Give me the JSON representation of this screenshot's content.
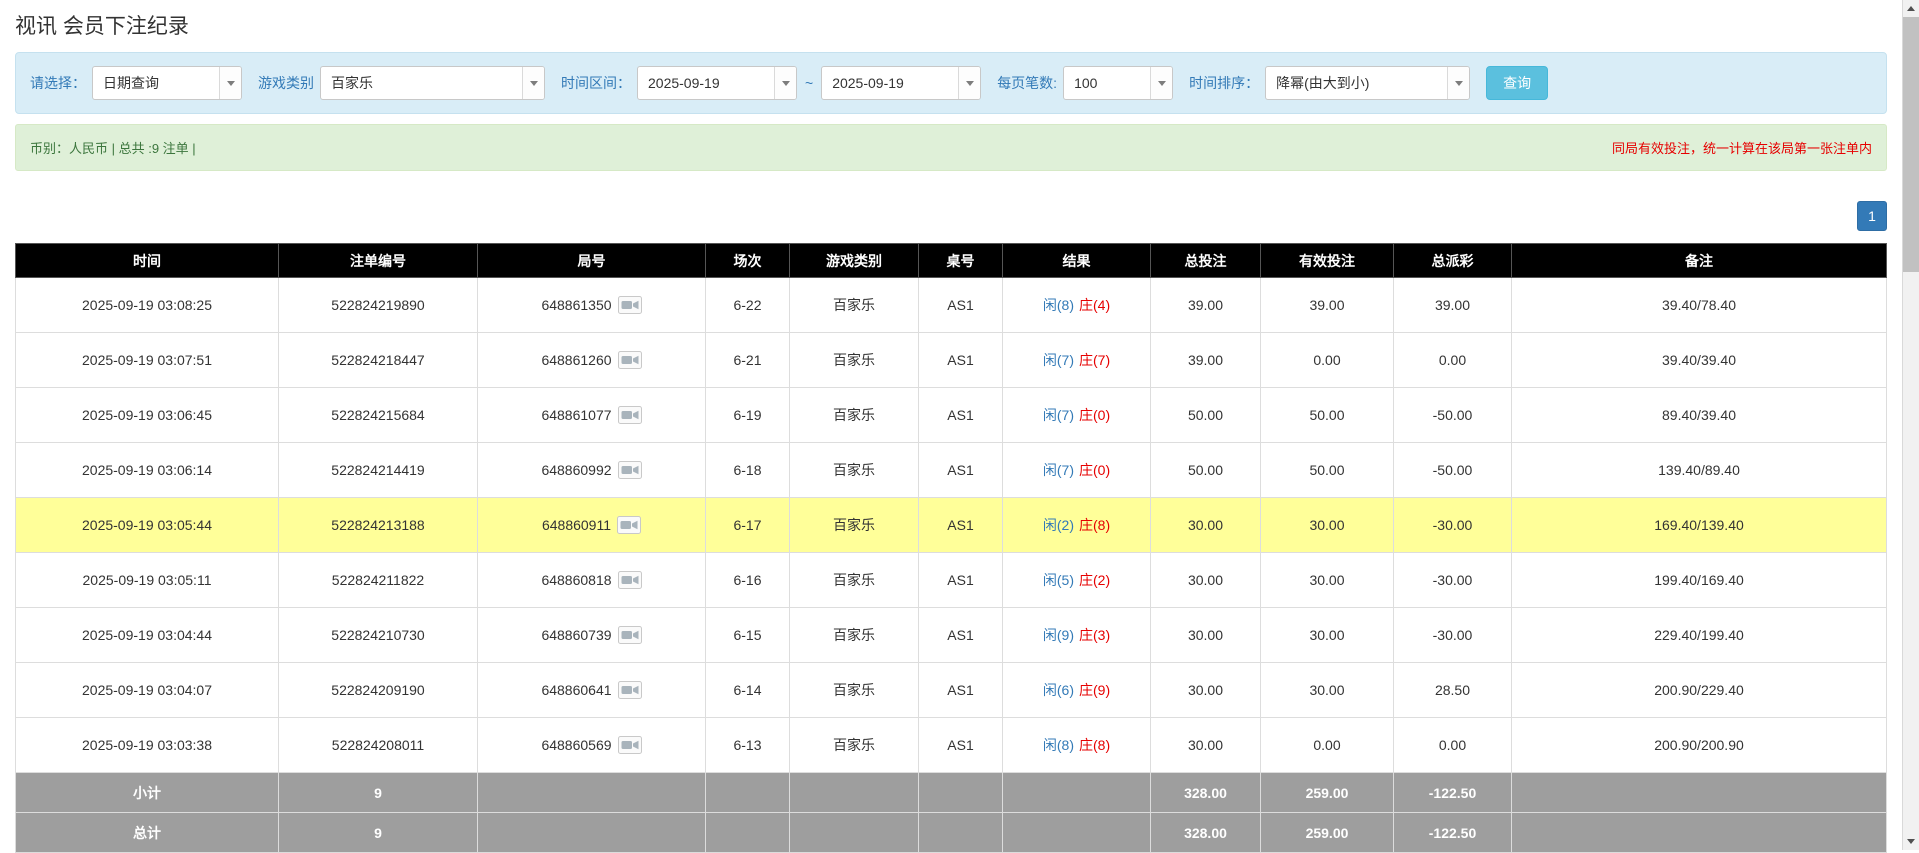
{
  "page": {
    "title": "视讯 会员下注纪录"
  },
  "filters": {
    "select_label": "请选择：",
    "select_value": "日期查询",
    "game_type_label": "游戏类别",
    "game_type_value": "百家乐",
    "date_range_label": "时间区间：",
    "date_from": "2025-09-19",
    "date_separator": "~",
    "date_to": "2025-09-19",
    "page_size_label": "每页笔数:",
    "page_size_value": "100",
    "sort_label": "时间排序：",
    "sort_value": "降幂(由大到小)",
    "search_button": "查询"
  },
  "summary": {
    "left": "币别：人民币 | 总共 :9 注单 |",
    "right": "同局有效投注，统一计算在该局第一张注单内"
  },
  "pagination": {
    "current": "1"
  },
  "table": {
    "headers": [
      "时间",
      "注单编号",
      "局号",
      "场次",
      "游戏类别",
      "桌号",
      "结果",
      "总投注",
      "有效投注",
      "总派彩",
      "备注"
    ],
    "rows": [
      {
        "time": "2025-09-19 03:08:25",
        "bet_id": "522824219890",
        "round": "648861350",
        "session": "6-22",
        "game": "百家乐",
        "table": "AS1",
        "player": "闲(8)",
        "banker": "庄(4)",
        "total_bet": "39.00",
        "valid_bet": "39.00",
        "payout": "39.00",
        "note": "39.40/78.40",
        "highlight": false
      },
      {
        "time": "2025-09-19 03:07:51",
        "bet_id": "522824218447",
        "round": "648861260",
        "session": "6-21",
        "game": "百家乐",
        "table": "AS1",
        "player": "闲(7)",
        "banker": "庄(7)",
        "total_bet": "39.00",
        "valid_bet": "0.00",
        "payout": "0.00",
        "note": "39.40/39.40",
        "highlight": false
      },
      {
        "time": "2025-09-19 03:06:45",
        "bet_id": "522824215684",
        "round": "648861077",
        "session": "6-19",
        "game": "百家乐",
        "table": "AS1",
        "player": "闲(7)",
        "banker": "庄(0)",
        "total_bet": "50.00",
        "valid_bet": "50.00",
        "payout": "-50.00",
        "note": "89.40/39.40",
        "highlight": false
      },
      {
        "time": "2025-09-19 03:06:14",
        "bet_id": "522824214419",
        "round": "648860992",
        "session": "6-18",
        "game": "百家乐",
        "table": "AS1",
        "player": "闲(7)",
        "banker": "庄(0)",
        "total_bet": "50.00",
        "valid_bet": "50.00",
        "payout": "-50.00",
        "note": "139.40/89.40",
        "highlight": false
      },
      {
        "time": "2025-09-19 03:05:44",
        "bet_id": "522824213188",
        "round": "648860911",
        "session": "6-17",
        "game": "百家乐",
        "table": "AS1",
        "player": "闲(2)",
        "banker": "庄(8)",
        "total_bet": "30.00",
        "valid_bet": "30.00",
        "payout": "-30.00",
        "note": "169.40/139.40",
        "highlight": true
      },
      {
        "time": "2025-09-19 03:05:11",
        "bet_id": "522824211822",
        "round": "648860818",
        "session": "6-16",
        "game": "百家乐",
        "table": "AS1",
        "player": "闲(5)",
        "banker": "庄(2)",
        "total_bet": "30.00",
        "valid_bet": "30.00",
        "payout": "-30.00",
        "note": "199.40/169.40",
        "highlight": false
      },
      {
        "time": "2025-09-19 03:04:44",
        "bet_id": "522824210730",
        "round": "648860739",
        "session": "6-15",
        "game": "百家乐",
        "table": "AS1",
        "player": "闲(9)",
        "banker": "庄(3)",
        "total_bet": "30.00",
        "valid_bet": "30.00",
        "payout": "-30.00",
        "note": "229.40/199.40",
        "highlight": false
      },
      {
        "time": "2025-09-19 03:04:07",
        "bet_id": "522824209190",
        "round": "648860641",
        "session": "6-14",
        "game": "百家乐",
        "table": "AS1",
        "player": "闲(6)",
        "banker": "庄(9)",
        "total_bet": "30.00",
        "valid_bet": "30.00",
        "payout": "28.50",
        "note": "200.90/229.40",
        "highlight": false
      },
      {
        "time": "2025-09-19 03:03:38",
        "bet_id": "522824208011",
        "round": "648860569",
        "session": "6-13",
        "game": "百家乐",
        "table": "AS1",
        "player": "闲(8)",
        "banker": "庄(8)",
        "total_bet": "30.00",
        "valid_bet": "0.00",
        "payout": "0.00",
        "note": "200.90/200.90",
        "highlight": false
      }
    ],
    "subtotal": {
      "label": "小计",
      "count": "9",
      "total_bet": "328.00",
      "valid_bet": "259.00",
      "payout": "-122.50"
    },
    "total": {
      "label": "总计",
      "count": "9",
      "total_bet": "328.00",
      "valid_bet": "259.00",
      "payout": "-122.50"
    }
  },
  "icons": {
    "combo_arrow": "chevron-down-icon",
    "round_media": "video-camera-icon",
    "scrollbar_up": "arrow-up-icon",
    "scrollbar_down": "arrow-down-icon"
  },
  "colors": {
    "accent_blue": "#337ab7",
    "filter_bar_bg": "#d9edf7",
    "summary_bar_bg": "#dff0d8",
    "header_bg": "#000000",
    "highlight_row_bg": "#ffff99",
    "footer_row_bg": "#9e9e9e",
    "negative_red": "#ee0000",
    "player_blue": "#337ab7",
    "banker_red": "#ee0000",
    "search_button_bg": "#5bc0de"
  }
}
